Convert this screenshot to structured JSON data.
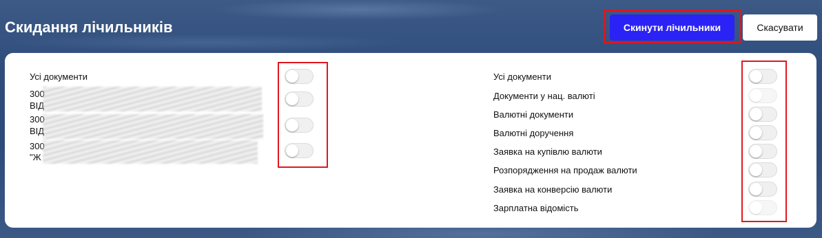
{
  "header": {
    "title": "Скидання лічильників",
    "reset_button": "Скинути лічильники",
    "cancel_button": "Скасувати"
  },
  "left_panel": {
    "all_documents_label": "Усі документи",
    "accounts": [
      {
        "line1": "300",
        "line2": "ВІД"
      },
      {
        "line1": "300",
        "line2": "ВІД"
      },
      {
        "line1": "300",
        "line2": "\"Ж"
      }
    ],
    "toggles": [
      {
        "on": false
      },
      {
        "on": false
      },
      {
        "on": false
      },
      {
        "on": false
      }
    ]
  },
  "right_panel": {
    "items": [
      {
        "label": "Усі документи",
        "on": false,
        "enabled": true
      },
      {
        "label": "Документи у нац. валюті",
        "on": false,
        "enabled": false
      },
      {
        "label": "Валютні документи",
        "on": false,
        "enabled": true
      },
      {
        "label": "Валютні доручення",
        "on": false,
        "enabled": true
      },
      {
        "label": "Заявка на купівлю валюти",
        "on": false,
        "enabled": true
      },
      {
        "label": "Розпорядження на продаж валюти",
        "on": false,
        "enabled": true
      },
      {
        "label": "Заявка на конверсію валюти",
        "on": false,
        "enabled": true
      },
      {
        "label": "Зарплатна відомість",
        "on": false,
        "enabled": false
      }
    ]
  },
  "colors": {
    "primary_button": "#2b22f5",
    "highlight": "#e0161e",
    "background": "#2f4d7c"
  }
}
